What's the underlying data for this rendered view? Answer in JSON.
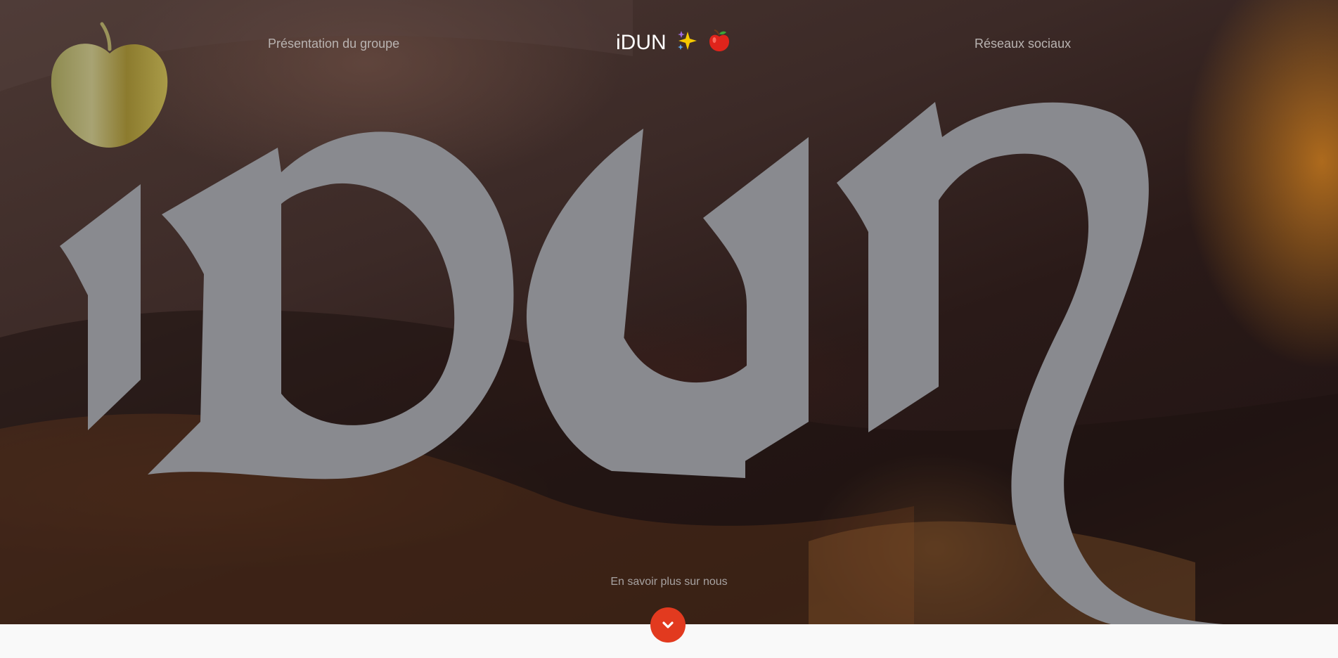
{
  "header": {
    "nav_left_label": "Présentation du groupe",
    "brand_label": "iDUN",
    "brand_icons": [
      "sparkles-icon",
      "red-apple-icon"
    ],
    "nav_right_label": "Réseaux sociaux"
  },
  "hero": {
    "logo_text": "idun",
    "logo_icon": "golden-apple-icon",
    "more_label": "En savoir plus sur nous",
    "scroll_icon": "chevron-down-icon"
  },
  "colors": {
    "accent": "#e23a1f",
    "logo_fill": "#898a8f",
    "nav_text": "#b9b3b1",
    "footer_bg": "#f9f9f9"
  }
}
